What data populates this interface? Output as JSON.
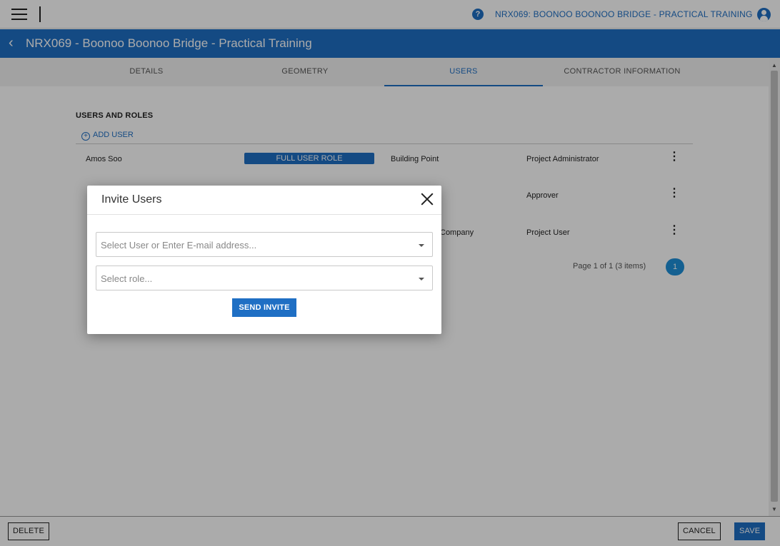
{
  "topbar": {
    "project_link": "NRX069: BOONOO BOONOO BRIDGE - PRACTICAL TRAINING",
    "help_icon": "?"
  },
  "header": {
    "back_icon": "‹",
    "title": "NRX069 - Boonoo Boonoo Bridge - Practical Training"
  },
  "tabs": [
    {
      "label": "DETAILS",
      "active": false
    },
    {
      "label": "GEOMETRY",
      "active": false
    },
    {
      "label": "USERS",
      "active": true
    },
    {
      "label": "CONTRACTOR INFORMATION",
      "active": false
    }
  ],
  "users_section": {
    "title": "USERS AND ROLES",
    "add_user_label": "ADD USER",
    "rows": [
      {
        "name": "Amos Soo",
        "badge": "FULL USER ROLE",
        "company": "Building Point",
        "role": "Project Administrator"
      },
      {
        "name": "",
        "badge": "",
        "company": "",
        "role": "Approver"
      },
      {
        "name": "",
        "badge": "",
        "company": "Company",
        "role": "Project User"
      }
    ],
    "pager_text": "Page 1 of 1 (3 items)",
    "pager_page": "1"
  },
  "footer": {
    "delete_label": "DELETE",
    "cancel_label": "CANCEL",
    "save_label": "SAVE"
  },
  "dialog": {
    "title": "Invite Users",
    "user_select_placeholder": "Select User or Enter E-mail address...",
    "role_select_placeholder": "Select role...",
    "send_label": "SEND INVITE"
  },
  "colors": {
    "accent": "#1f6fc4",
    "pager": "#1f8fd8"
  }
}
